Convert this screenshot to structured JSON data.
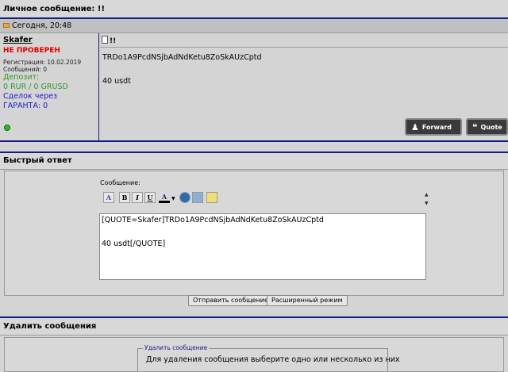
{
  "header": {
    "title": "Личное сообщение: !!"
  },
  "post": {
    "date": "Сегодня, 20:48",
    "subject": "!!",
    "body_line1": "TRDo1A9PcdNSjbAdNdKetu8ZoSkAUzCptd",
    "body_line2": "40 usdt",
    "author": {
      "name": "Skafer",
      "status": "НЕ ПРОВЕРЕН",
      "registration": "Регистрация: 10.02.2019",
      "messages": "Сообщений: 0",
      "deposit_label": "Депозит:",
      "deposit_value": "0 RUR / 0 GRUSD",
      "deals_label": "Сделок через",
      "guarant": "ГАРАНТА: 0"
    },
    "forward_label": "Forward",
    "quote_label": "Quote"
  },
  "quick_reply": {
    "title": "Быстрый ответ",
    "message_label": "Сообщение:",
    "toolbar": {
      "bold": "B",
      "italic": "I",
      "underline": "U",
      "color": "A"
    },
    "text_line1": "[QUOTE=Skafer]TRDo1A9PcdNSjbAdNdKetu8ZoSkAUzCptd",
    "text_line2": "40 usdt[/QUOTE]",
    "send_label": "Отправить сообщение",
    "advanced_label": "Расширенный режим"
  },
  "delete": {
    "title": "Удалить сообщения",
    "legend": "Удалить сообщение",
    "text": "Для удаления сообщения выберите одно или несколько из них"
  },
  "colors": {
    "accent": "#1a1a80",
    "unverified": "#e00000",
    "deposit": "#2a9a2a",
    "link": "#1a1ad0"
  }
}
